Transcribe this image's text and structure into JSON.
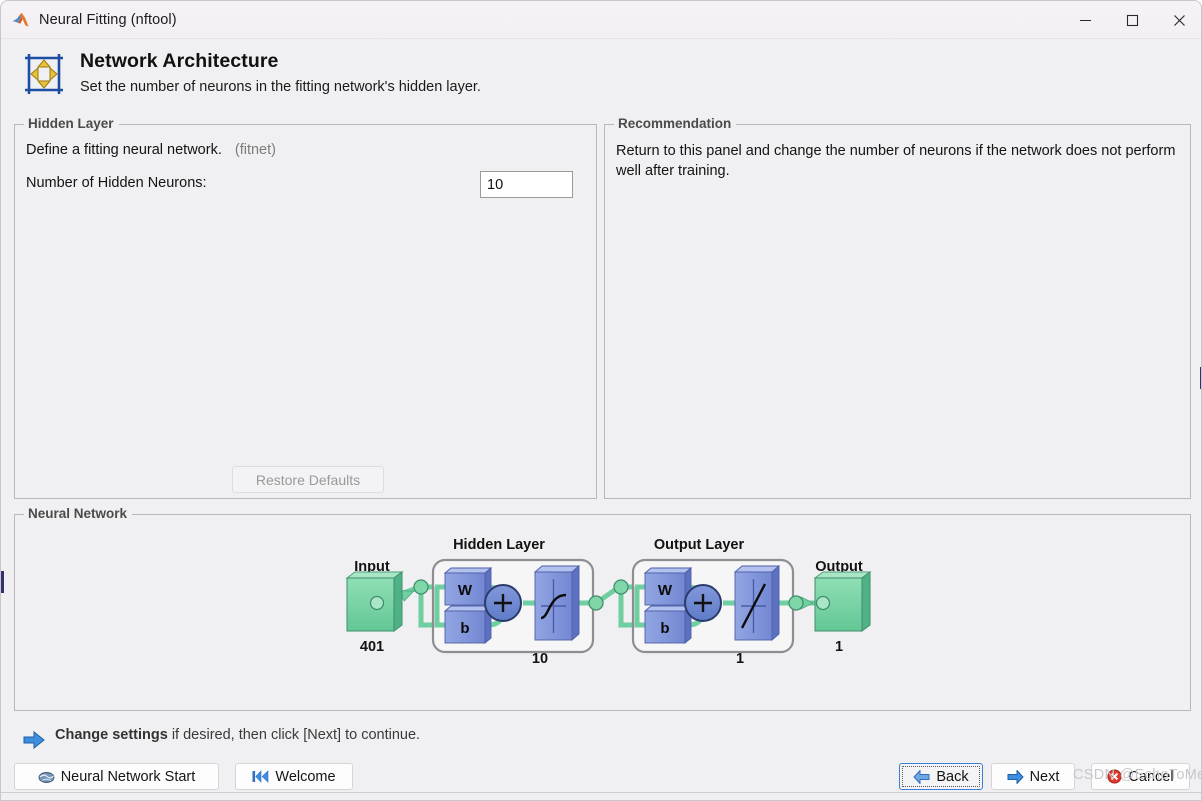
{
  "window": {
    "title": "Neural Fitting (nftool)",
    "logo_icon": "matlab-logo-icon",
    "controls": {
      "minimize": "minimize-icon",
      "maximize": "maximize-icon",
      "close": "close-icon"
    }
  },
  "header": {
    "icon": "network-architecture-icon",
    "title": "Network Architecture",
    "subtitle": "Set the number of neurons in the fitting network's hidden layer."
  },
  "hidden_layer_panel": {
    "legend": "Hidden Layer",
    "define_text": "Define a fitting neural network.",
    "function_tag": "(fitnet)",
    "neurons_label": "Number of Hidden Neurons:",
    "neurons_value": "10",
    "neurons_placeholder": "",
    "restore_defaults_label": "Restore Defaults",
    "restore_defaults_enabled": false
  },
  "recommendation_panel": {
    "legend": "Recommendation",
    "text": "Return to this panel and change the number of neurons if the network does not perform well after training."
  },
  "network_panel": {
    "legend": "Neural Network",
    "diagram": {
      "input": {
        "label": "Input",
        "size": "401"
      },
      "hidden_layer": {
        "title": "Hidden Layer",
        "weight_label": "W",
        "bias_label": "b",
        "sum_label": "+",
        "transfer_function": "sigmoid",
        "size": "10"
      },
      "output_layer": {
        "title": "Output Layer",
        "weight_label": "W",
        "bias_label": "b",
        "sum_label": "+",
        "transfer_function": "linear",
        "size": "1"
      },
      "output": {
        "label": "Output",
        "size": "1"
      },
      "colors": {
        "node_green": "#7fd6a8",
        "block_blue": "#7f96dd",
        "sum_circle": "#6d8ad4",
        "layer_border": "#8e8e92"
      }
    }
  },
  "footer": {
    "hint_icon": "right-arrow-icon",
    "hint_bold": "Change settings",
    "hint_rest": " if desired, then click [Next] to continue.",
    "buttons": {
      "neural_network_start": {
        "label": "Neural Network Start",
        "icon": "brain-icon"
      },
      "welcome": {
        "label": "Welcome",
        "icon": "skip-back-icon"
      },
      "back": {
        "label": "Back",
        "icon": "back-arrow-icon",
        "focused": true
      },
      "next": {
        "label": "Next",
        "icon": "next-arrow-icon"
      },
      "cancel": {
        "label": "Cancel",
        "icon": "cancel-icon"
      }
    }
  },
  "watermark": {
    "text": "CSDN @EchoToMe"
  }
}
